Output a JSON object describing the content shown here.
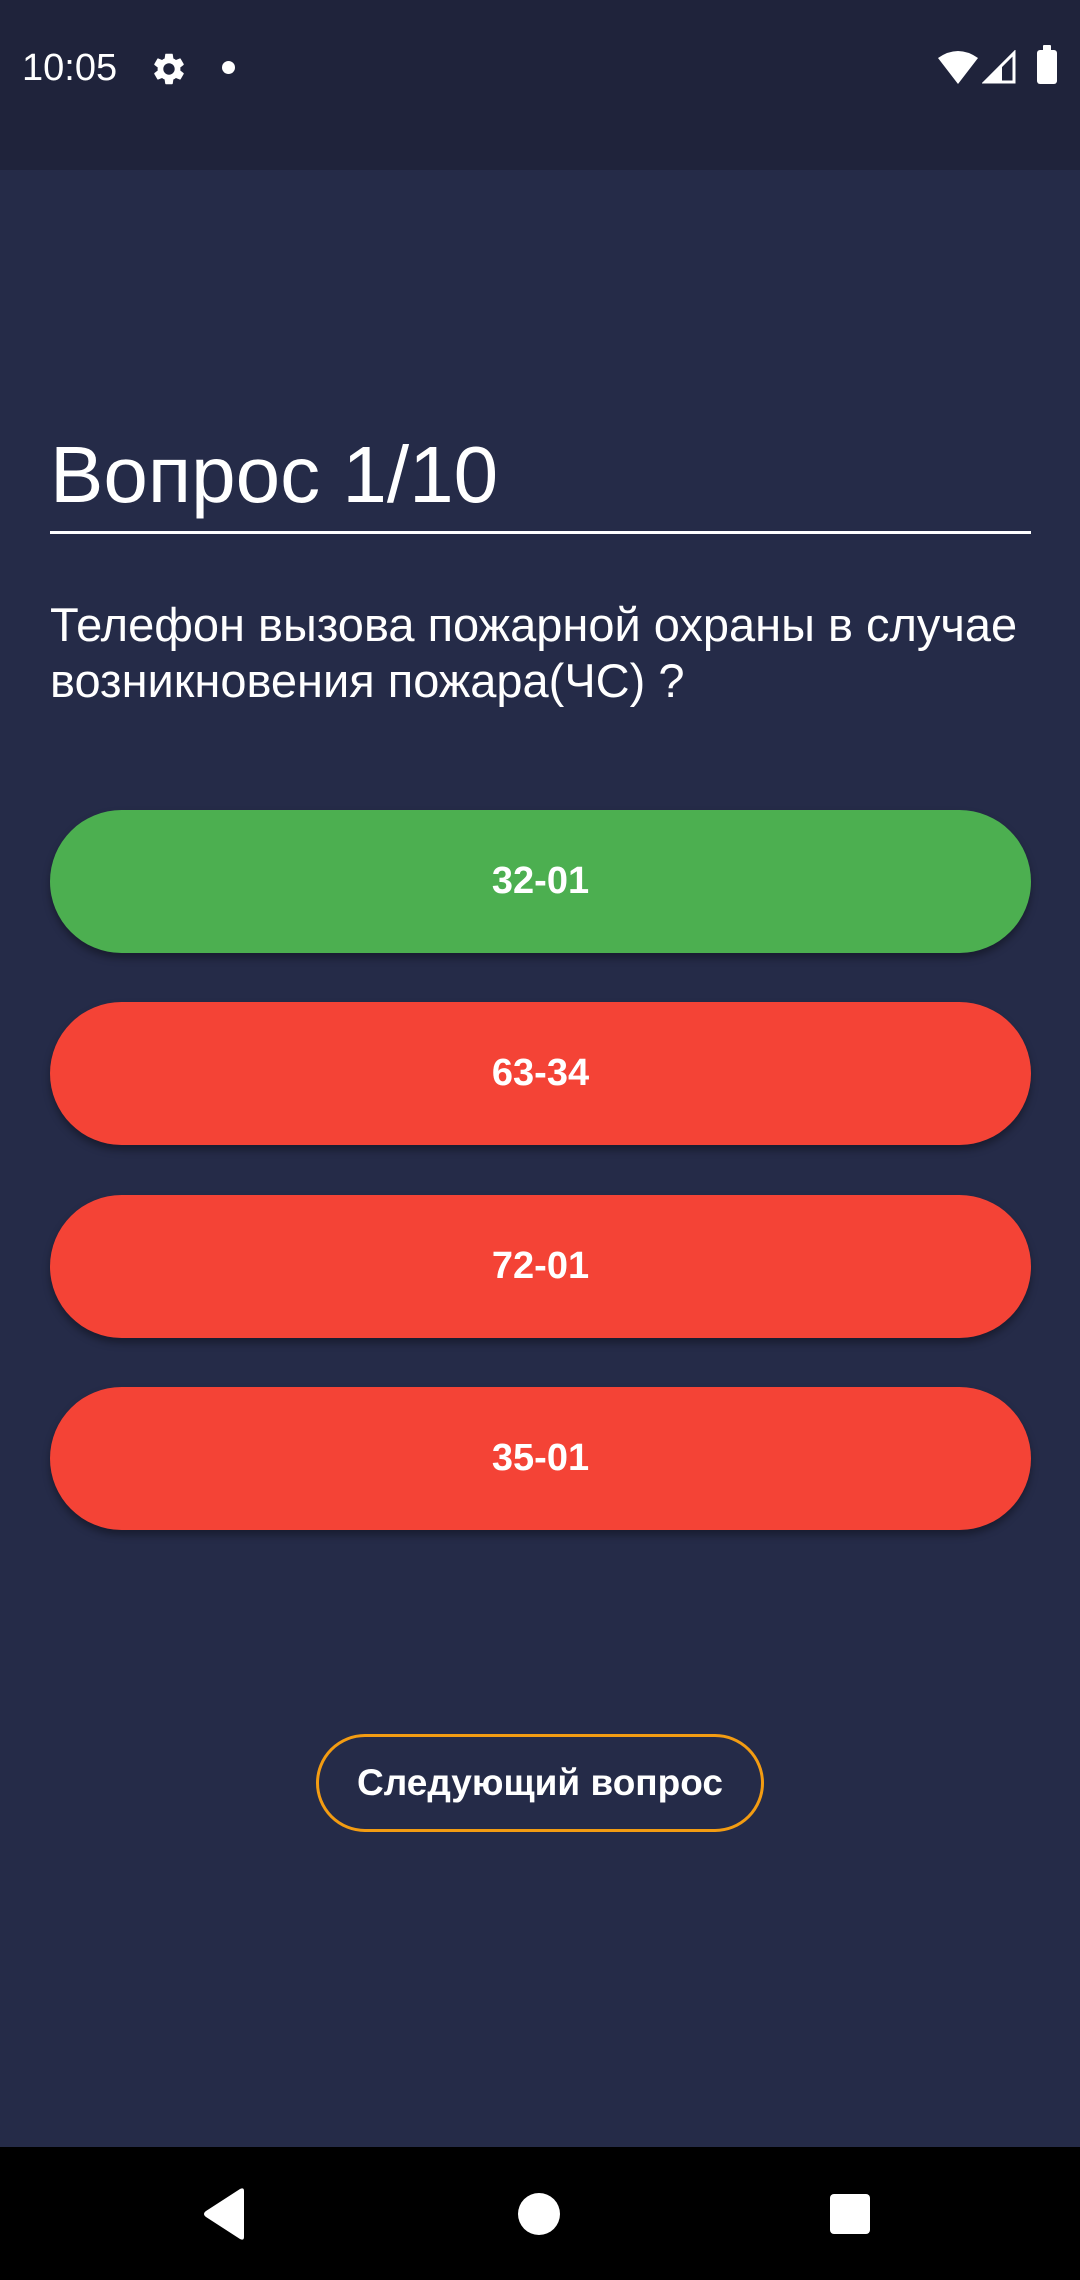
{
  "status_bar": {
    "time": "10:05",
    "icons": [
      "gear-icon",
      "notification-dot-icon",
      "wifi-icon",
      "signal-icon",
      "battery-icon"
    ]
  },
  "quiz": {
    "counter": "Вопрос 1/10",
    "question": "Телефон вызова пожарной охраны в случае возникновения пожара(ЧС) ?",
    "answers": [
      {
        "label": "32-01",
        "state": "correct"
      },
      {
        "label": "63-34",
        "state": "wrong"
      },
      {
        "label": "72-01",
        "state": "wrong"
      },
      {
        "label": "35-01",
        "state": "wrong"
      }
    ],
    "next_label": "Следующий вопрос"
  },
  "colors": {
    "background": "#252b48",
    "status_bar": "#1f233b",
    "correct": "#4caf50",
    "wrong": "#f44336",
    "next_border": "#f39c12"
  },
  "nav_bar": {
    "icons": [
      "back-icon",
      "home-icon",
      "recents-icon"
    ]
  }
}
